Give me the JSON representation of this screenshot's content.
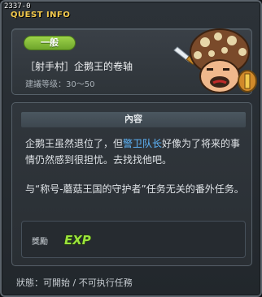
{
  "window": {
    "quest_id": "2337-0",
    "title": "QUEST INFO"
  },
  "quest": {
    "category": "一般",
    "title": "［射手村］企鹅王的卷轴",
    "level": "建議等级：30～50",
    "npc_icon": "mushroom-king-npc-icon"
  },
  "content": {
    "header": "內容",
    "desc_part1": "企鹅王虽然退位了，但",
    "desc_highlight": "警卫队长",
    "desc_part2": "好像为了将来的事情仍然感到很担忧。去找找他吧。",
    "desc_line2": "与“称号-蘑菇王国的守护者”任务无关的番外任务。"
  },
  "reward": {
    "label": "獎勵",
    "exp_text": "EXP",
    "exp_icon": "exp-icon"
  },
  "status": {
    "text": "狀態：可開始 / 不可执行任務"
  },
  "colors": {
    "title_gold": "#f2c94c",
    "badge_green": "#7fb935",
    "highlight_blue": "#5fb8ff",
    "exp_green": "#9be23c"
  }
}
